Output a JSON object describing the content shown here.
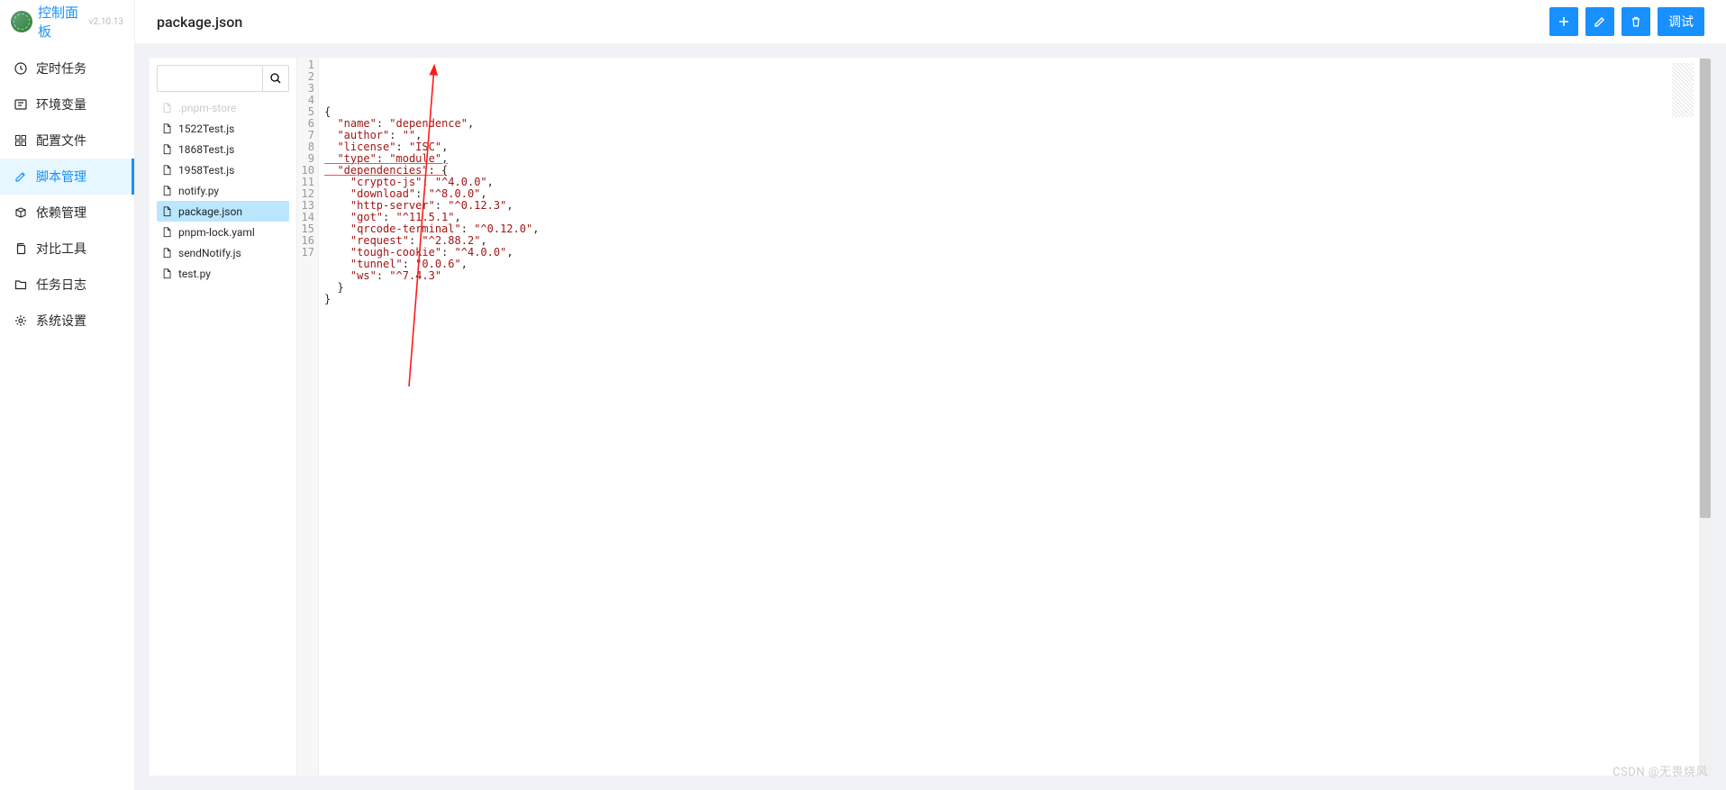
{
  "brand": {
    "title": "控制面板",
    "version": "v2.10.13"
  },
  "menu": [
    {
      "key": "cron",
      "label": "定时任务",
      "icon": "clock"
    },
    {
      "key": "env",
      "label": "环境变量",
      "icon": "field"
    },
    {
      "key": "config",
      "label": "配置文件",
      "icon": "grid"
    },
    {
      "key": "script",
      "label": "脚本管理",
      "icon": "edit",
      "active": true
    },
    {
      "key": "dep",
      "label": "依赖管理",
      "icon": "box"
    },
    {
      "key": "diff",
      "label": "对比工具",
      "icon": "copy"
    },
    {
      "key": "log",
      "label": "任务日志",
      "icon": "folder"
    },
    {
      "key": "setting",
      "label": "系统设置",
      "icon": "gear"
    }
  ],
  "header": {
    "title": "package.json",
    "actions": {
      "debug_label": "调试"
    }
  },
  "file_panel": {
    "search_placeholder": "",
    "files": [
      {
        "name": ".pnpm-store",
        "dimmed": true
      },
      {
        "name": "1522Test.js"
      },
      {
        "name": "1868Test.js"
      },
      {
        "name": "1958Test.js"
      },
      {
        "name": "notify.py"
      },
      {
        "name": "package.json",
        "selected": true
      },
      {
        "name": "pnpm-lock.yaml"
      },
      {
        "name": "sendNotify.js"
      },
      {
        "name": "test.py"
      }
    ]
  },
  "editor": {
    "line_count": 17,
    "lines": [
      "{",
      "  \"name\": \"dependence\",",
      "  \"author\": \"\",",
      "  \"license\": \"ISC\",",
      "  \"type\": \"module\",",
      "  \"dependencies\": {",
      "    \"crypto-js\": \"^4.0.0\",",
      "    \"download\": \"^8.0.0\",",
      "    \"http-server\": \"^0.12.3\",",
      "    \"got\": \"^11.5.1\",",
      "    \"qrcode-terminal\": \"^0.12.0\",",
      "    \"request\": \"^2.88.2\",",
      "    \"tough-cookie\": \"^4.0.0\",",
      "    \"tunnel\": \"0.0.6\",",
      "    \"ws\": \"^7.4.3\"",
      "  }",
      "}"
    ],
    "underlined_lines": [
      5,
      6
    ]
  },
  "watermark": "CSDN @无畏烧风"
}
